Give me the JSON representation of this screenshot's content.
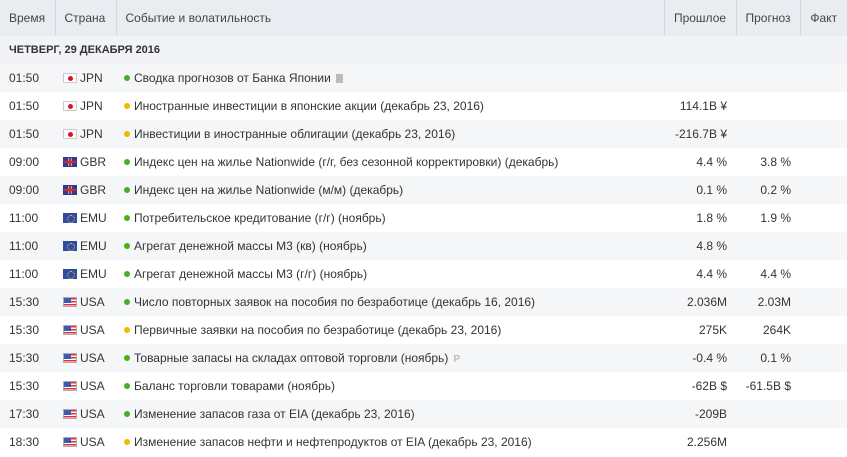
{
  "header": {
    "time": "Время",
    "country": "Страна",
    "event": "Событие и волатильность",
    "previous": "Прошлое",
    "forecast": "Прогноз",
    "actual": "Факт"
  },
  "date_label": "ЧЕТВЕРГ, 29 ДЕКАБРЯ 2016",
  "colors": {
    "low": "#4caf1a",
    "medium": "#f7b500"
  },
  "events": [
    {
      "time": "01:50",
      "country": "JPN",
      "volatility": "low",
      "event": "Сводка прогнозов от Банка Японии",
      "icon": "document-icon",
      "previous": "",
      "forecast": "",
      "actual": ""
    },
    {
      "time": "01:50",
      "country": "JPN",
      "volatility": "med",
      "event": "Иностранные инвестиции в японские акции (декабрь 23, 2016)",
      "previous": "114.1B ¥",
      "forecast": "",
      "actual": ""
    },
    {
      "time": "01:50",
      "country": "JPN",
      "volatility": "med",
      "event": "Инвестиции в иностранные облигации (декабрь 23, 2016)",
      "previous": "-216.7B ¥",
      "forecast": "",
      "actual": ""
    },
    {
      "time": "09:00",
      "country": "GBR",
      "volatility": "low",
      "event": "Индекс цен на жилье Nationwide (г/г, без сезонной корректировки) (декабрь)",
      "previous": "4.4 %",
      "forecast": "3.8 %",
      "actual": ""
    },
    {
      "time": "09:00",
      "country": "GBR",
      "volatility": "low",
      "event": "Индекс цен на жилье Nationwide (м/м) (декабрь)",
      "previous": "0.1 %",
      "forecast": "0.2 %",
      "actual": ""
    },
    {
      "time": "11:00",
      "country": "EMU",
      "volatility": "low",
      "event": "Потребительское кредитование (г/г) (ноябрь)",
      "previous": "1.8 %",
      "forecast": "1.9 %",
      "actual": ""
    },
    {
      "time": "11:00",
      "country": "EMU",
      "volatility": "low",
      "event": "Агрегат денежной массы M3 (кв) (ноябрь)",
      "previous": "4.8 %",
      "forecast": "",
      "actual": ""
    },
    {
      "time": "11:00",
      "country": "EMU",
      "volatility": "low",
      "event": "Агрегат денежной массы M3 (г/г) (ноябрь)",
      "previous": "4.4 %",
      "forecast": "4.4 %",
      "actual": ""
    },
    {
      "time": "15:30",
      "country": "USA",
      "volatility": "low",
      "event": "Число повторных заявок на пособия по безработице (декабрь 16, 2016)",
      "previous": "2.036M",
      "forecast": "2.03M",
      "actual": ""
    },
    {
      "time": "15:30",
      "country": "USA",
      "volatility": "med",
      "event": "Первичные заявки на пособия по безработице (декабрь 23, 2016)",
      "previous": "275K",
      "forecast": "264K",
      "actual": ""
    },
    {
      "time": "15:30",
      "country": "USA",
      "volatility": "low",
      "event": "Товарные запасы на складах оптовой торговли (ноябрь)",
      "tag": "P",
      "previous": "-0.4 %",
      "forecast": "0.1 %",
      "actual": ""
    },
    {
      "time": "15:30",
      "country": "USA",
      "volatility": "low",
      "event": "Баланс торговли товарами (ноябрь)",
      "previous": "-62B $",
      "forecast": "-61.5B $",
      "actual": ""
    },
    {
      "time": "17:30",
      "country": "USA",
      "volatility": "low",
      "event": "Изменение запасов газа от EIA (декабрь 23, 2016)",
      "previous": "-209B",
      "forecast": "",
      "actual": ""
    },
    {
      "time": "18:30",
      "country": "USA",
      "volatility": "med",
      "event": "Изменение запасов нефти и нефтепродуктов от EIA (декабрь 23, 2016)",
      "previous": "2.256M",
      "forecast": "",
      "actual": ""
    }
  ]
}
